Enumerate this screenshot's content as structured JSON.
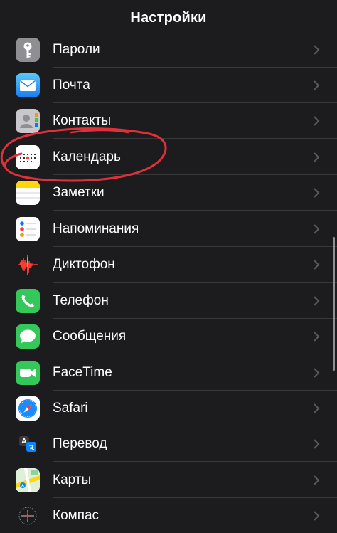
{
  "navbar": {
    "title": "Настройки"
  },
  "settings": {
    "items": [
      {
        "label": "Пароли",
        "icon": "key-icon"
      },
      {
        "label": "Почта",
        "icon": "mail-icon"
      },
      {
        "label": "Контакты",
        "icon": "contacts-icon"
      },
      {
        "label": "Календарь",
        "icon": "calendar-icon"
      },
      {
        "label": "Заметки",
        "icon": "notes-icon"
      },
      {
        "label": "Напоминания",
        "icon": "reminders-icon"
      },
      {
        "label": "Диктофон",
        "icon": "voice-memos-icon"
      },
      {
        "label": "Телефон",
        "icon": "phone-icon"
      },
      {
        "label": "Сообщения",
        "icon": "messages-icon"
      },
      {
        "label": "FaceTime",
        "icon": "facetime-icon"
      },
      {
        "label": "Safari",
        "icon": "safari-icon"
      },
      {
        "label": "Перевод",
        "icon": "translate-icon"
      },
      {
        "label": "Карты",
        "icon": "maps-icon"
      },
      {
        "label": "Компас",
        "icon": "compass-icon"
      }
    ]
  },
  "colors": {
    "background": "#1c1c1e",
    "separator": "#38383a",
    "chevron": "#5a5a5e",
    "annotation": "#e0303a"
  }
}
